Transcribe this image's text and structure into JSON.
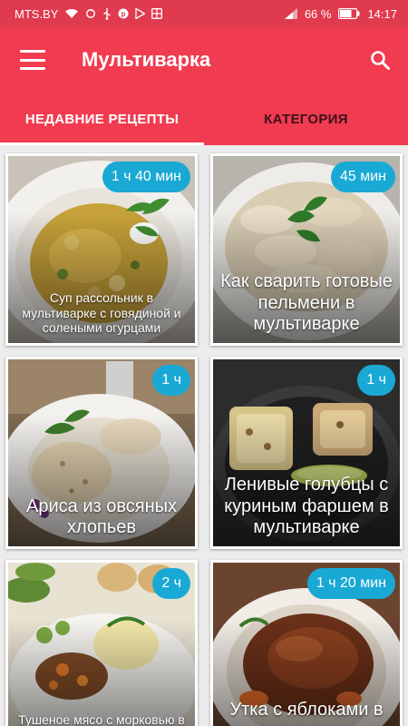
{
  "status": {
    "carrier": "MTS.BY",
    "battery": "66 %",
    "time": "14:17"
  },
  "appbar": {
    "title": "Мультиварка"
  },
  "tabs": [
    {
      "label": "НЕДАВНИЕ РЕЦЕПТЫ",
      "active": true
    },
    {
      "label": "КАТЕГОРИЯ",
      "active": false
    }
  ],
  "recipes": [
    {
      "title": "Суп рассольник в мультиварке с говядиной и солеными огурцами",
      "time": "1 ч 40 мин"
    },
    {
      "title": "Как сварить готовые пельмени в мультиварке",
      "time": "45 мин"
    },
    {
      "title": "Ариса из овсяных хлопьев",
      "time": "1 ч"
    },
    {
      "title": "Ленивые голубцы с куриным фаршем в мультиварке",
      "time": "1 ч"
    },
    {
      "title": "Тушеное мясо с морковью в мультиварке",
      "time": "2 ч"
    },
    {
      "title": "Утка с яблоками в мультиварке",
      "time": "1 ч 20 мин"
    }
  ],
  "colors": {
    "statusbar": "#e03a4e",
    "appbar": "#f13b50",
    "badge": "#19a9d4"
  }
}
